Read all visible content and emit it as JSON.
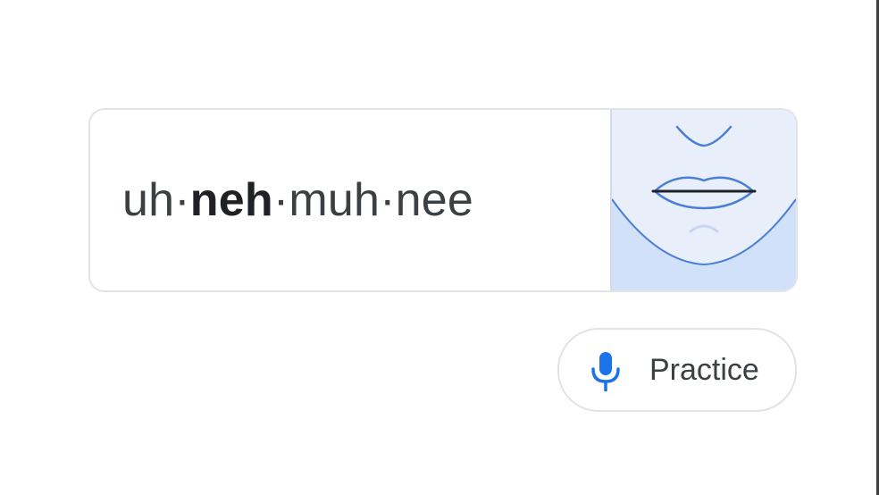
{
  "pronunciation": {
    "syllables": [
      {
        "text": "uh",
        "stressed": false
      },
      {
        "text": "·",
        "stressed": false
      },
      {
        "text": "neh",
        "stressed": true
      },
      {
        "text": "·muh·nee",
        "stressed": false
      }
    ]
  },
  "mouth_diagram": {
    "icon": "mouth-shape-illustration"
  },
  "practice": {
    "label": "Practice",
    "icon": "microphone-icon"
  },
  "colors": {
    "accent": "#1a73e8",
    "panel": "#e8effb",
    "text": "#3c4043"
  }
}
